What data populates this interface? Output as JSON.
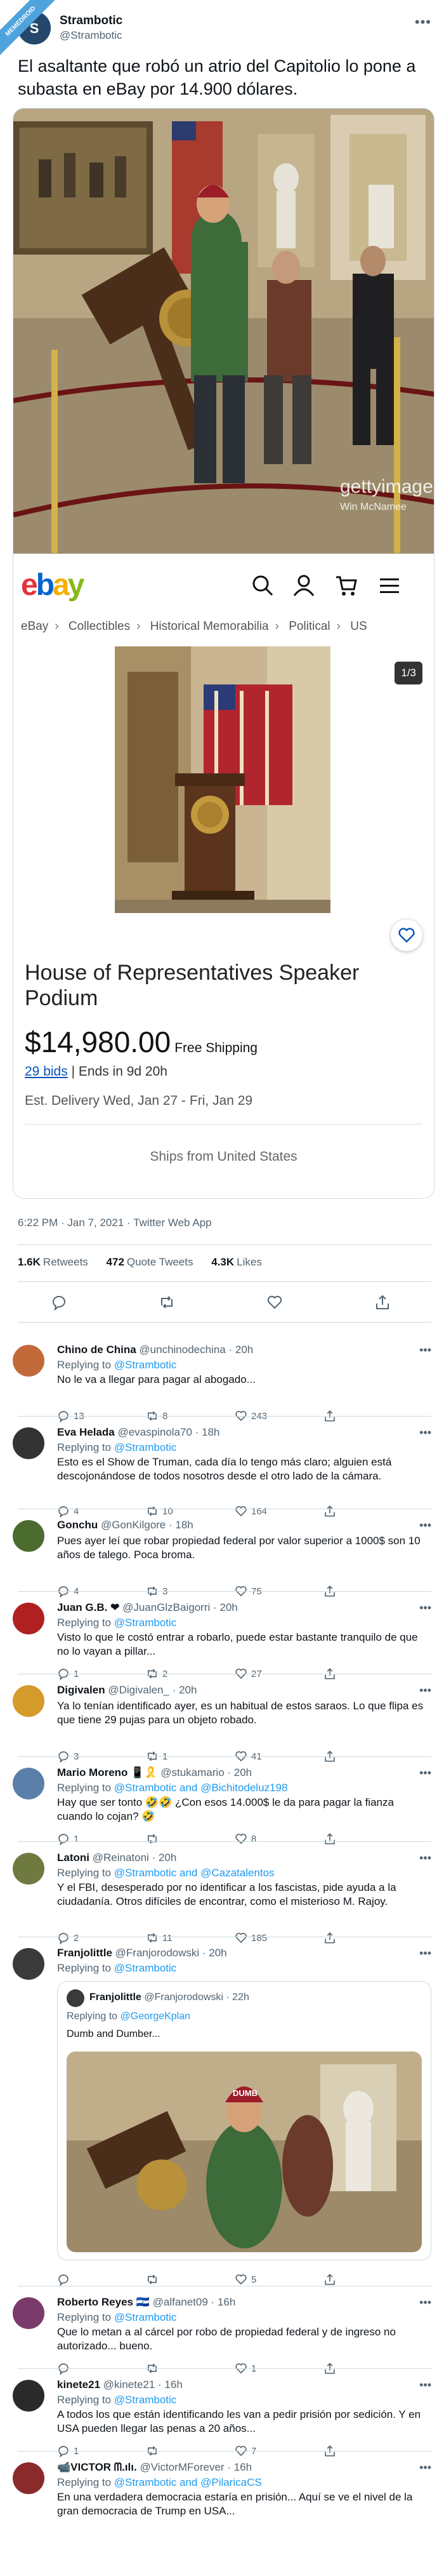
{
  "corner_badge": "MEMEDROID",
  "tweet": {
    "author_name": "Strambotic",
    "author_handle": "@Strambotic",
    "text": "El asaltante que robó un atrio del Capitolio lo pone a subasta en eBay por 14.900 dólares.",
    "photo_watermark": "gettyimages",
    "photo_credit": "Win McNamee",
    "timestamp": "6:22 PM · Jan 7, 2021 · Twitter Web App",
    "retweets": "1.6K",
    "retweets_label": "Retweets",
    "quote_tweets": "472",
    "quote_tweets_label": "Quote Tweets",
    "likes": "4.3K",
    "likes_label": "Likes"
  },
  "ebay": {
    "breadcrumbs": [
      "eBay",
      "Collectibles",
      "Historical Memorabilia",
      "Political",
      "US"
    ],
    "gallery_counter": "1/3",
    "title": "House of Representatives Speaker Podium",
    "price": "$14,980.00",
    "shipping": "Free Shipping",
    "bids_link": "29 bids",
    "ends": "| Ends in 9d 20h",
    "delivery": "Est. Delivery Wed, Jan 27 - Fri, Jan 29",
    "ships_from": "Ships from United States"
  },
  "replies": [
    {
      "name": "Chino de China",
      "handle": "@unchinodechina · 20h",
      "to": "@Strambotic",
      "text": "No le va a llegar para pagar al abogado...",
      "c": "13",
      "r": "8",
      "l": "243",
      "color": "#c26a3a"
    },
    {
      "name": "Eva Helada",
      "handle": "@evaspinola70 · 18h",
      "to": "@Strambotic",
      "text": "Esto es el Show de Truman, cada día lo tengo más claro; alguien está descojonándose de todos nosotros desde el otro lado de la cámara.",
      "c": "4",
      "r": "10",
      "l": "164",
      "color": "#333333"
    },
    {
      "name": "Gonchu",
      "handle": "@GonKilgore · 18h",
      "to": "",
      "text": "Pues ayer leí que robar propiedad federal por valor superior a 1000$ son 10 años de talego. Poca broma.",
      "c": "4",
      "r": "3",
      "l": "75",
      "color": "#4b6b2f"
    },
    {
      "name": "Juan G.B. ❤",
      "handle": "@JuanGlzBaigorri · 20h",
      "to": "@Strambotic",
      "text": "Visto lo que le costó entrar a robarlo, puede estar bastante tranquilo de que no lo vayan a pillar...",
      "c": "1",
      "r": "2",
      "l": "27",
      "color": "#b02020"
    },
    {
      "name": "Digivalen",
      "handle": "@Digivalen_ · 20h",
      "to": "",
      "text": "Ya lo tenían identificado ayer, es un habitual de estos saraos. Lo que flipa es que tiene 29 pujas para un objeto robado.",
      "c": "3",
      "r": "1",
      "l": "41",
      "color": "#d49a2a"
    },
    {
      "name": "Mario Moreno 📱🎗️",
      "handle": "@stukamario · 20h",
      "to": "@Strambotic and @Bichitodeluz198",
      "text": "Hay que ser tonto 🤣🤣 ¿Con esos 14.000$ le da para pagar la fianza cuando lo cojan? 🤣",
      "c": "1",
      "r": "",
      "l": "8",
      "color": "#5a7fa8"
    },
    {
      "name": "Latoni",
      "handle": "@Reinatoni · 20h",
      "to": "@Strambotic and @Cazatalentos",
      "text": "Y el FBI, desesperado por no identificar a los fascistas, pide ayuda a la ciudadanía. Otros difíciles de encontrar, como el misterioso M. Rajoy.",
      "c": "2",
      "r": "11",
      "l": "185",
      "color": "#6f7a40"
    },
    {
      "name": "Franjolittle",
      "handle": "@Franjorodowski · 20h",
      "to": "@Strambotic",
      "text": "",
      "c": "",
      "r": "",
      "l": "5",
      "color": "#3a3a3a"
    },
    {
      "name": "Roberto Reyes 🇸🇻",
      "handle": "@alfanet09 · 16h",
      "to": "@Strambotic",
      "text": "Que lo metan a al cárcel por robo de propiedad federal y de ingreso no autorizado... bueno.",
      "c": "",
      "r": "",
      "l": "1",
      "color": "#7a3a6a"
    },
    {
      "name": "kinete21",
      "handle": "@kinete21 · 16h",
      "to": "@Strambotic",
      "text": "A todos los que están identificando les van a pedir prisión por sedición. Y en USA pueden llegar las penas a 20 años...",
      "c": "1",
      "r": "",
      "l": "7",
      "color": "#2a2a2a"
    },
    {
      "name": "📹VICTOR ᗰ.ılı.",
      "handle": "@VictorMForever · 16h",
      "to": "@Strambotic and @PilaricaCS",
      "text": "En una verdadera democracia estaría en prisión... Aquí se ve el nivel de la gran democracia de Trump en USA...",
      "c": "",
      "r": "",
      "l": "1",
      "color": "#8a2a2a"
    }
  ],
  "quote": {
    "name": "Franjolittle",
    "handle": "@Franjorodowski · 22h",
    "to_prefix": "Replying to",
    "to": "@GeorgeKplan",
    "text": "Dumb and Dumber...",
    "hat_text": "DUMB"
  },
  "labels": {
    "replying_to": "Replying to"
  },
  "colors": {
    "accent": "#1d9bf0",
    "ebay_link": "#0654ba"
  }
}
